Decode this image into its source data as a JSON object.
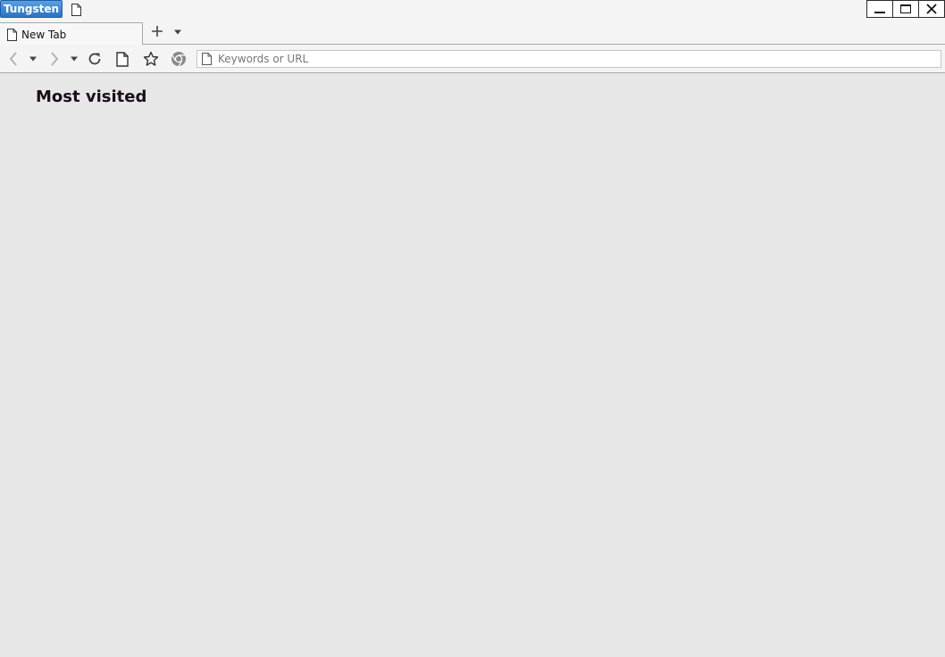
{
  "titlebar": {
    "app_menu_label": "Tungsten",
    "icons": [
      "page-icon",
      "minimize-icon",
      "maximize-icon",
      "close-icon"
    ]
  },
  "tabs": [
    {
      "label": "New Tab",
      "icon": "page-icon",
      "active": true
    }
  ],
  "tabstrip": {
    "icons": [
      "plus-icon",
      "caret-down-icon"
    ]
  },
  "toolbar": {
    "icons": [
      "back-icon",
      "caret-down-icon",
      "forward-icon",
      "caret-down-icon",
      "reload-icon",
      "page-icon",
      "star-icon",
      "chrome-icon"
    ],
    "address": {
      "value": "",
      "placeholder": "Keywords or URL"
    }
  },
  "content": {
    "section_title": "Most visited"
  },
  "colors": {
    "app_button": "#2b73c4",
    "chrome_bg": "#f4f4f4",
    "page_bg": "#e7e7e7",
    "title_text": "#1a0d1a"
  }
}
